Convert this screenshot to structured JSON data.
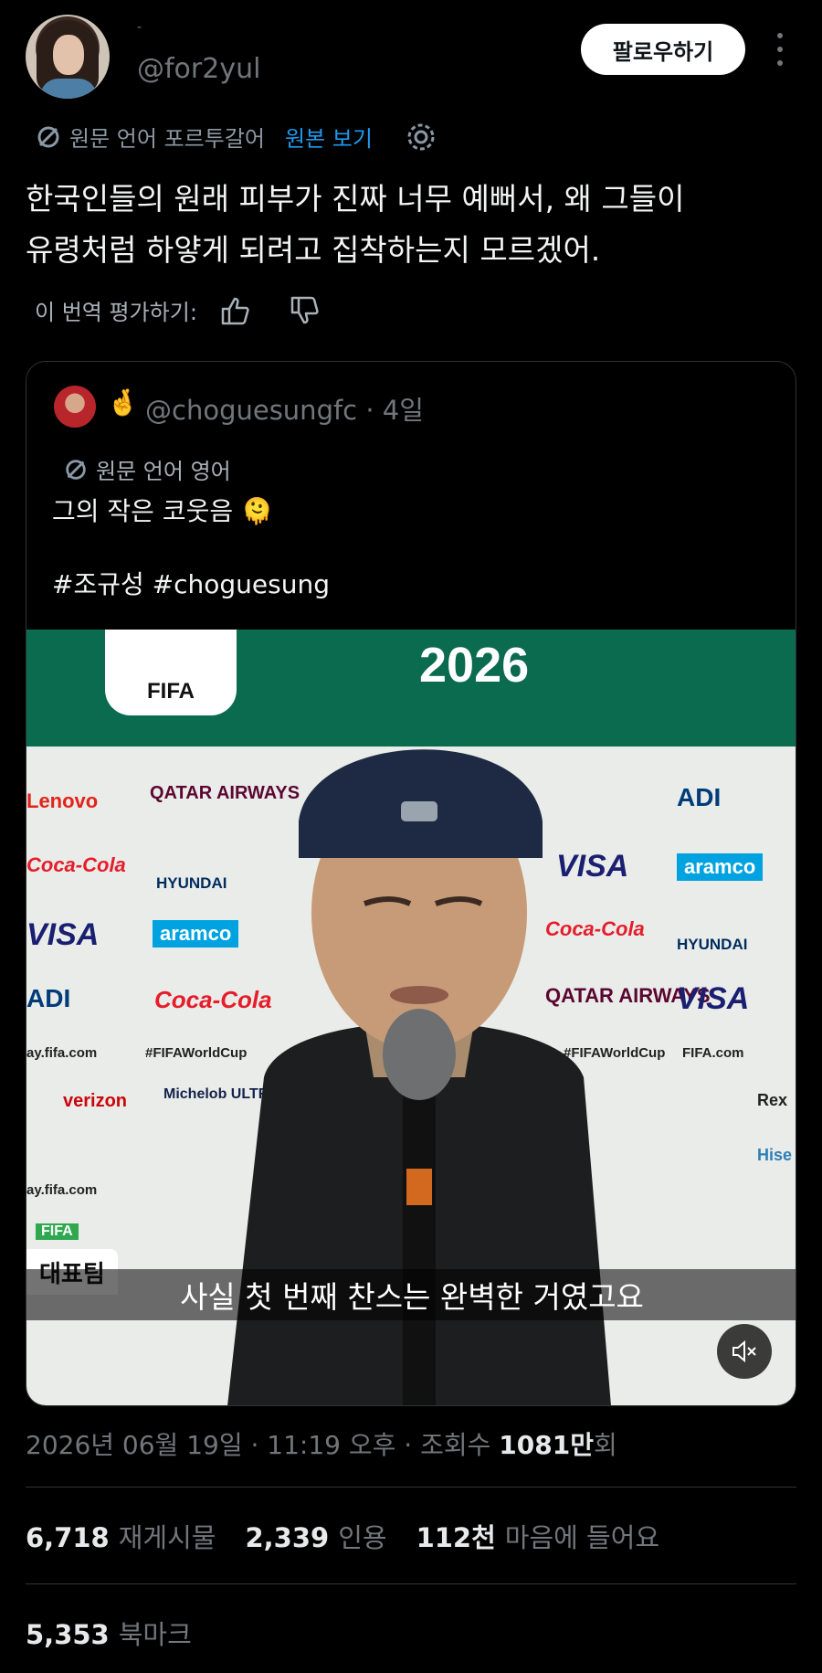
{
  "header": {
    "name_mark": "-",
    "handle": "@for2yul",
    "follow_label": "팔로우하기"
  },
  "translation": {
    "source_label": "원문 언어 포르투갈어",
    "view_original": "원본 보기",
    "text_line1": "한국인들의 원래 피부가 진짜 너무 예뻐서, 왜 그들이",
    "text_line2": "유령처럼 하얗게 되려고 집착하는지 모르겠어.",
    "rate_label": "이 번역 평가하기:"
  },
  "quote": {
    "emoji": "🤞",
    "handle": "@choguesungfc · 4일",
    "source_label": "원문 언어 영어",
    "text": "그의 작은 코웃음 🫠",
    "hashtags": "#조규성 #choguesung",
    "video": {
      "banner_text": "2026",
      "fifa_text": "FIFA",
      "team_tag": "대표팀",
      "subtitle": "사실 첫 번째 찬스는 완벽한 거였고요",
      "sponsors_left": [
        "Lenovo",
        "QATAR AIRWAYS",
        "Coca-Cola",
        "HYUNDAI",
        "VISA",
        "aramco",
        "ADI",
        "Coca-Cola",
        "ay.fifa.com",
        "#FIFAWorldCup",
        "verizon",
        "Michelob ULTRA",
        "ay.fifa.com",
        "FIFA"
      ],
      "sponsors_right": [
        "ADI",
        "VISA",
        "aramco",
        "Coca-Cola",
        "HYUNDAI",
        "QATAR AIRWAYS",
        "VISA",
        "#FIFAWorldCup",
        "FIFA.com",
        "Rex",
        "Hise"
      ]
    }
  },
  "meta": {
    "date": "2026년 06월 19일 · 11:19 오후 · 조회수 ",
    "views": "1081만",
    "views_suffix": "회"
  },
  "stats": {
    "reposts_count": "6,718",
    "reposts_label": "재게시물",
    "quotes_count": "2,339",
    "quotes_label": "인용",
    "likes_count": "112천",
    "likes_label": "마음에 들어요",
    "bookmarks_count": "5,353",
    "bookmarks_label": "북마크"
  },
  "colors": {
    "background": "#000000",
    "link": "#1d9bf0",
    "muted": "#71767b"
  }
}
